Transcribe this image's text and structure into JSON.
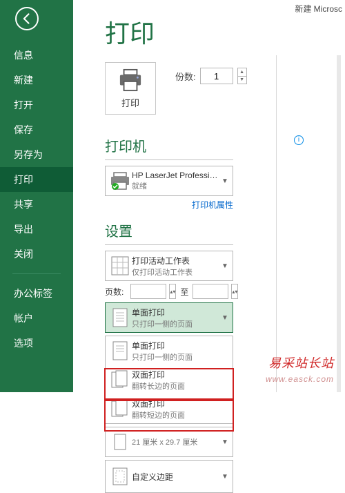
{
  "app_title": "新建 Microsc",
  "sidebar": {
    "items": [
      "信息",
      "新建",
      "打开",
      "保存",
      "另存为",
      "打印",
      "共享",
      "导出",
      "关闭"
    ],
    "footer": [
      "办公标签",
      "帐户",
      "选项"
    ],
    "active_index": 5
  },
  "page": {
    "title": "打印",
    "print_button": "打印",
    "copies_label": "份数:",
    "copies_value": "1"
  },
  "printer": {
    "section": "打印机",
    "name": "HP LaserJet Profession...",
    "status": "就绪",
    "properties_link": "打印机属性"
  },
  "settings": {
    "section": "设置",
    "sheet_title": "打印活动工作表",
    "sheet_sub": "仅打印活动工作表",
    "pages_label": "页数:",
    "to_label": "至",
    "pages_from": "",
    "pages_to": "",
    "duplex_selected_title": "单面打印",
    "duplex_selected_sub": "只打印一侧的页面",
    "duplex_options": [
      {
        "title": "单面打印",
        "sub": "只打印一侧的页面"
      },
      {
        "title": "双面打印",
        "sub": "翻转长边的页面"
      },
      {
        "title": "双面打印",
        "sub": "翻转短边的页面"
      }
    ],
    "paper_partial": "21 厘米 x 29.7 厘米",
    "margins": "自定义边距"
  },
  "watermark": {
    "line1": "易采站长站",
    "line2": "www.easck.com"
  }
}
